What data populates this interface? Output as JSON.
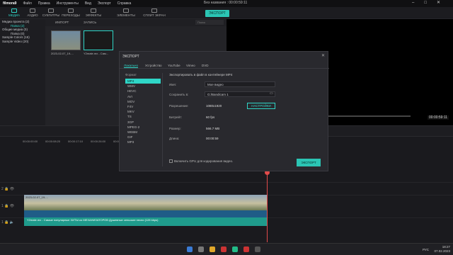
{
  "app": {
    "name": "filmora9",
    "title": "Без названия : 00:00:59:11"
  },
  "menu": [
    "Файл",
    "Правка",
    "Инструменты",
    "Вид",
    "Экспорт",
    "Справка"
  ],
  "toolbar": {
    "tabs": [
      "МЕДИА",
      "АУДИО",
      "СУБТИТРЫ",
      "ПЕРЕХОДЫ",
      "ЭФФЕКТЫ",
      "ЭЛЕМЕНТЫ",
      "СПЛИТ ЭКРАН"
    ],
    "export_label": "ЭКСПОРТ"
  },
  "left_panel": {
    "items": [
      "Медиа проекта (2)",
      "Папка (2)",
      "Общие медиа (0)",
      "Папка (0)",
      "Sample Colors (15)",
      "Sample Video (20)"
    ]
  },
  "media_bar": {
    "import": "ИМПОРТ",
    "record": "ЗАПИСЬ",
    "search_placeholder": "Поиск"
  },
  "media_items": [
    {
      "label": "2023-02-07_19-..."
    },
    {
      "label": "Y2mate.mx - Сам..."
    }
  ],
  "preview": {
    "time": "00:00:59:11"
  },
  "export_dialog": {
    "title": "ЭКСПОРТ",
    "tabs": [
      "Локально",
      "Устройство",
      "YouTube",
      "Vimeo",
      "DVD"
    ],
    "format_header": "Формат",
    "formats": [
      "MP4",
      "WMV",
      "HEVC",
      "AVI",
      "MOV",
      "F4V",
      "MKV",
      "TS",
      "3GP",
      "MPEG-2",
      "WEBM",
      "GIF",
      "MP3"
    ],
    "selected_format": "MP4",
    "description": "Экспортировать в файл в контейнере MP4",
    "fields": {
      "name_label": "Имя:",
      "name_value": "Мое видео",
      "save_label": "Сохранить в:",
      "save_value": "G:/Bandicam 1",
      "resolution_label": "Разрешение:",
      "resolution_value": "1080x1920",
      "settings_button": "НАСТРОЙКИ",
      "framerate_label": "Битрейт:",
      "framerate_value": "60 fps",
      "size_label": "Размер:",
      "size_value": "566.7 MB",
      "duration_label": "Длина:",
      "duration_value": "00:00:59"
    },
    "gpu_label": "Включить GPU для кодирования видео.",
    "export_button": "ЭКСПОРТ"
  },
  "timeline": {
    "ruler": [
      "00:00:00:00",
      "00:00:08:20",
      "00:00:17:10",
      "00:00:26:00",
      "00:00:34:20",
      "00:00:43:10",
      "00:00:52:00",
      "00:01:00:20",
      "00:01:09:10",
      "00:01:18:00",
      "00:01:26:20",
      "00:01:35:10",
      "00:01:44:00"
    ],
    "video_clip_label": "2023-02-07_19-...",
    "audio_clip_label": "Y2mate.mx - Самые популярные ХИТЫ из МЕХАНИЗАТОРОВ Душевные сельские песни (128 kbps)"
  },
  "taskbar": {
    "time": "18:27",
    "date": "07.02.2023",
    "lang": "РУС"
  }
}
